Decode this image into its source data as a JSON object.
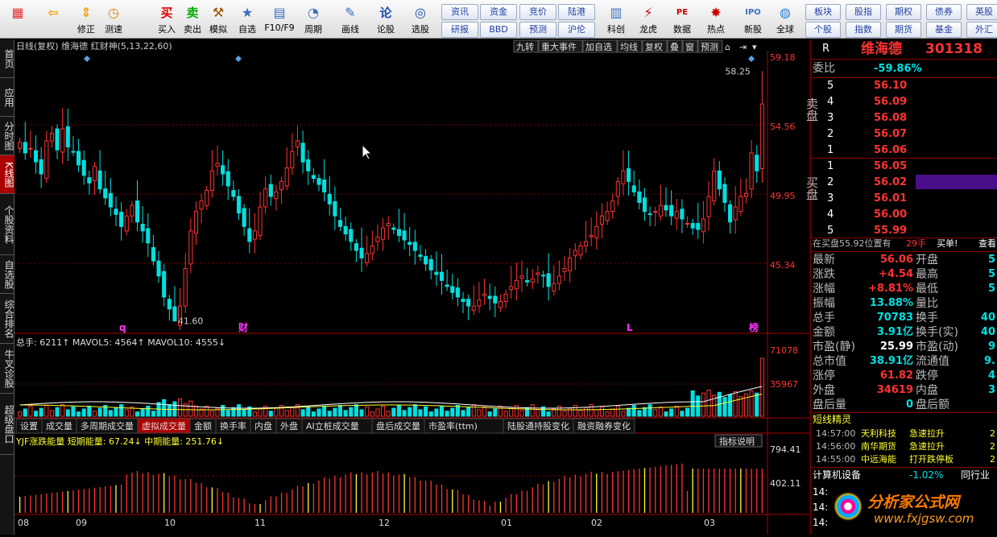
{
  "toolbar": {
    "tools": [
      {
        "label": "",
        "icon": "home-icon"
      },
      {
        "label": "",
        "icon": "back-arrow-icon"
      },
      {
        "label": "修正",
        "icon": "up-down-icon"
      },
      {
        "label": "测速",
        "icon": "clock-icon"
      },
      {
        "label": "买入",
        "icon": "buy-icon",
        "glyph": "买"
      },
      {
        "label": "卖出",
        "icon": "sell-icon",
        "glyph": "卖"
      },
      {
        "label": "模拟",
        "icon": "hammer-icon"
      },
      {
        "label": "自选",
        "icon": "star-icon"
      },
      {
        "label": "F10/F9",
        "icon": "f10-icon"
      },
      {
        "label": "周期",
        "icon": "cycle-icon"
      },
      {
        "label": "画线",
        "icon": "pencil-icon"
      },
      {
        "label": "论股",
        "icon": "forum-icon",
        "glyph": "论"
      },
      {
        "label": "选股",
        "icon": "magnifier-icon"
      },
      {
        "label": "科创",
        "icon": "kechuang-icon"
      },
      {
        "label": "龙虎",
        "icon": "longhu-icon"
      },
      {
        "label": "数据",
        "icon": "pe-icon",
        "glyph": "PE"
      },
      {
        "label": "热点",
        "icon": "hot-icon"
      },
      {
        "label": "新股",
        "icon": "ipo-icon",
        "glyph": "IPO"
      },
      {
        "label": "全球",
        "icon": "globe-icon"
      }
    ],
    "link_buttons": [
      "资讯",
      "资金",
      "竞价",
      "陆港",
      "研报",
      "BBD",
      "预测",
      "沪伦",
      "板块",
      "股指",
      "期权",
      "债券",
      "英股",
      "个股",
      "指数",
      "期货",
      "基金",
      "外汇"
    ]
  },
  "sidebar": [
    "首页",
    "应用",
    "分时图",
    "K线图",
    "个股资料",
    "自选股",
    "综合排名",
    "牛叉诊股",
    "超级盘口"
  ],
  "chart": {
    "header_title": "日线(复权)  维海德  红财神(5,13,22,60)",
    "top_buttons": [
      "九转",
      "重大事件",
      "加自选",
      "均线",
      "复权",
      "叠",
      "窗",
      "预测"
    ],
    "price_ticks": [
      "59.18",
      "54.56",
      "49.95",
      "45.34"
    ],
    "high_label": "58.25",
    "low_label": "41.60",
    "markers": [
      "q",
      "财",
      "L",
      "榜"
    ],
    "vol_title": "总手: 6211↑  MAVOL5: 4564↑  MAVOL10: 4555↓",
    "vol_ticks": [
      "71078",
      "35967"
    ],
    "tabs": [
      "设置",
      "成交量",
      "多周期成交量",
      "虚拟成交量",
      "金额",
      "换手率",
      "内盘",
      "外盘",
      "AI立桩成交量",
      "盘后成交量",
      "市盈率(ttm)",
      "陆股通持股变化",
      "融资融券变化"
    ],
    "ind_title": "YJF涨跌能量 短期能量: 67.24↓  中期能量: 251.76↓",
    "ind_button": "指标说明",
    "ind_ticks": [
      "794.41",
      "402.11"
    ],
    "x_labels": [
      "08",
      "09",
      "10",
      "11",
      "12",
      "01",
      "02",
      "03"
    ],
    "colors": {
      "up": "#ff3232",
      "down": "#00e0e0",
      "grid": "#7a0000",
      "yellow": "#ffff33",
      "magenta": "#ff33ff"
    }
  },
  "quote": {
    "code_label": "R",
    "name": "维海德",
    "code": "301318",
    "webi": {
      "label": "委比",
      "value": "-59.86%"
    },
    "sell_side": "卖盘",
    "buy_side": "买盘",
    "sells": [
      {
        "n": "5",
        "p": "56.10"
      },
      {
        "n": "4",
        "p": "56.09"
      },
      {
        "n": "3",
        "p": "56.08"
      },
      {
        "n": "2",
        "p": "56.07"
      },
      {
        "n": "1",
        "p": "56.06"
      }
    ],
    "buys": [
      {
        "n": "1",
        "p": "56.05"
      },
      {
        "n": "2",
        "p": "56.02"
      },
      {
        "n": "3",
        "p": "56.01"
      },
      {
        "n": "4",
        "p": "56.00"
      },
      {
        "n": "5",
        "p": "55.99"
      }
    ],
    "notice": "在买盘55.92位置有",
    "notice_qty": "29手",
    "notice_tag": "买单!",
    "notice_link": "查看",
    "stats": [
      {
        "l": "最新",
        "v": "56.06",
        "vc": "red",
        "r": "开盘",
        "rv": "5"
      },
      {
        "l": "涨跌",
        "v": "+4.54",
        "vc": "red",
        "r": "最高",
        "rv": "5"
      },
      {
        "l": "涨幅",
        "v": "+8.81%",
        "vc": "red",
        "r": "最低",
        "rv": "5"
      },
      {
        "l": "振幅",
        "v": "13.88%",
        "vc": "grn",
        "r": "量比",
        "rv": ""
      },
      {
        "l": "总手",
        "v": "70783",
        "vc": "grn",
        "r": "换手",
        "rv": "40"
      },
      {
        "l": "金额",
        "v": "3.91亿",
        "vc": "grn",
        "r": "换手(实)",
        "rv": "40"
      },
      {
        "l": "市盈(静)",
        "v": "25.99",
        "vc": "wht",
        "r": "市盈(动)",
        "rv": "9"
      },
      {
        "l": "总市值",
        "v": "38.91亿",
        "vc": "grn",
        "r": "流通值",
        "rv": "9."
      },
      {
        "l": "涨停",
        "v": "61.82",
        "vc": "red",
        "r": "跌停",
        "rv": "4"
      },
      {
        "l": "外盘",
        "v": "34619",
        "vc": "red",
        "r": "内盘",
        "rv": "3"
      },
      {
        "l": "盘后量",
        "v": "0",
        "vc": "grn",
        "r": "盘后额",
        "rv": ""
      }
    ],
    "elf_title": "短线精灵",
    "elf": [
      {
        "t": "14:57:00",
        "s": "天利科技",
        "e": "急速拉升",
        "x": "2"
      },
      {
        "t": "14:56:00",
        "s": "南华期货",
        "e": "急速拉升",
        "x": "2"
      },
      {
        "t": "14:55:00",
        "s": "中远海能",
        "e": "打开跌停板",
        "x": "2"
      }
    ],
    "sector": {
      "name": "计算机设备",
      "chg": "-1.02%",
      "link": "同行业"
    },
    "bottom_times": [
      "14:",
      "14:",
      "14:"
    ],
    "watermark": "分析家公式网",
    "watermark_url": "www.fxjgsw.com"
  }
}
